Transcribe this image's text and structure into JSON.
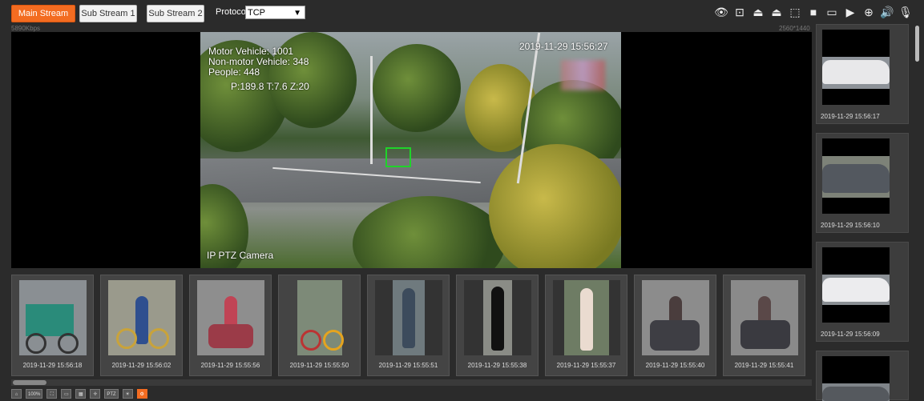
{
  "toolbar": {
    "main_stream": "Main Stream",
    "sub_stream_1": "Sub Stream 1",
    "sub_stream_2": "Sub Stream 2",
    "protocol_label": "Protocol",
    "protocol_value": "TCP"
  },
  "video": {
    "bitrate": "5890Kbps",
    "resolution": "2560*1440",
    "timestamp": "2019-11-29 15:56:27",
    "osd_motor": "Motor Vehicle: 1001",
    "osd_nonmotor": "Non-motor Vehicle: 348",
    "osd_people": "People: 448",
    "osd_ptz": "P:189.8 T:7.6 Z:20",
    "camera_name": "IP PTZ Camera"
  },
  "thumbnails": [
    {
      "time": "2019-11-29 15:56:18"
    },
    {
      "time": "2019-11-29 15:56:02"
    },
    {
      "time": "2019-11-29 15:55:56"
    },
    {
      "time": "2019-11-29 15:55:50"
    },
    {
      "time": "2019-11-29 15:55:51"
    },
    {
      "time": "2019-11-29 15:55:38"
    },
    {
      "time": "2019-11-29 15:55:37"
    },
    {
      "time": "2019-11-29 15:55:40"
    },
    {
      "time": "2019-11-29 15:55:41"
    }
  ],
  "side_cards": [
    {
      "time": "2019-11-29 15:56:17"
    },
    {
      "time": "2019-11-29 15:56:10"
    },
    {
      "time": "2019-11-29 15:56:09"
    },
    {
      "time": ""
    }
  ],
  "bottom_tools": {
    "zoom": "100%",
    "ptz": "PTZ"
  },
  "colors": {
    "accent": "#f36c21",
    "detection_box": "#1fd32a"
  }
}
